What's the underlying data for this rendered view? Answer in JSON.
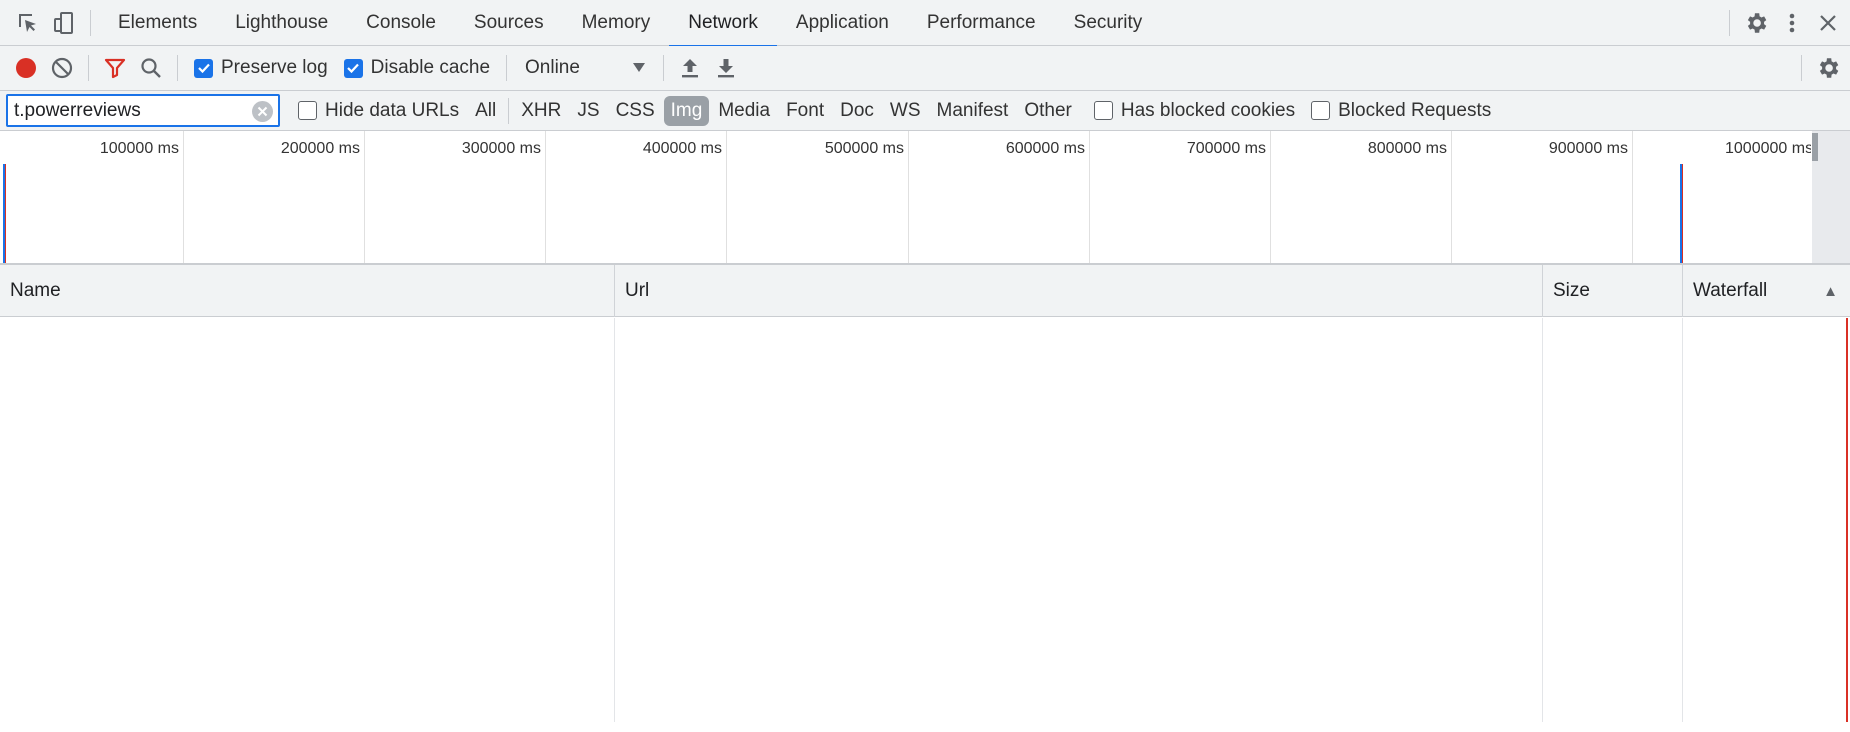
{
  "tabs": [
    {
      "label": "Elements"
    },
    {
      "label": "Lighthouse"
    },
    {
      "label": "Console"
    },
    {
      "label": "Sources"
    },
    {
      "label": "Memory"
    },
    {
      "label": "Network"
    },
    {
      "label": "Application"
    },
    {
      "label": "Performance"
    },
    {
      "label": "Security"
    }
  ],
  "active_tab": "Network",
  "toolbar": {
    "preserve_log": "Preserve log",
    "disable_cache": "Disable cache",
    "throttling": "Online"
  },
  "filter": {
    "value": "t.powerreviews",
    "hide_data_urls": "Hide data URLs",
    "types": [
      "All",
      "XHR",
      "JS",
      "CSS",
      "Img",
      "Media",
      "Font",
      "Doc",
      "WS",
      "Manifest",
      "Other"
    ],
    "active_type": "Img",
    "has_blocked_cookies": "Has blocked cookies",
    "blocked_requests": "Blocked Requests"
  },
  "overview": {
    "ticks": [
      "100000 ms",
      "200000 ms",
      "300000 ms",
      "400000 ms",
      "500000 ms",
      "600000 ms",
      "700000 ms",
      "800000 ms",
      "900000 ms",
      "1000000 ms"
    ]
  },
  "columns": {
    "name": "Name",
    "url": "Url",
    "size": "Size",
    "waterfall": "Waterfall",
    "sort_indicator": "▲"
  },
  "colors": {
    "accent": "#1a73e8",
    "record": "#d93025",
    "filter_icon": "#d93025",
    "timeline_marker_blue": "#1a73e8",
    "timeline_marker_red": "#d93025"
  }
}
